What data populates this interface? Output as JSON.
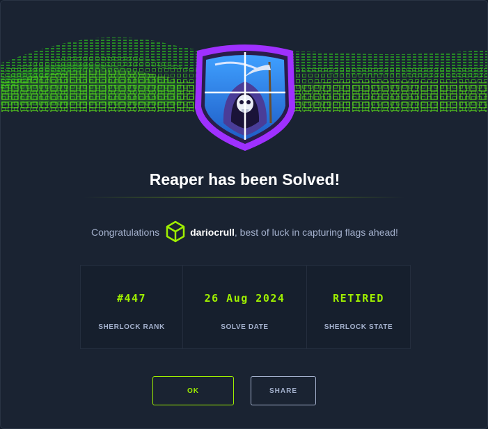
{
  "colors": {
    "accent": "#9fef00",
    "background": "#1a2332",
    "text_muted": "#a4b1cd",
    "badge_border": "#9f30ff"
  },
  "header": {
    "hero_graphic": "green-cube-wave",
    "badge_icon": "reaper-shield-badge"
  },
  "title": "Reaper has been Solved!",
  "congrats": {
    "prefix": "Congratulations",
    "avatar_icon": "green-cube-icon",
    "username": "dariocrull",
    "suffix": ", best of luck in capturing flags ahead!"
  },
  "stats": [
    {
      "value": "#447",
      "label": "SHERLOCK RANK"
    },
    {
      "value": "26 Aug 2024",
      "label": "SOLVE DATE"
    },
    {
      "value": "RETIRED",
      "label": "SHERLOCK STATE"
    }
  ],
  "buttons": {
    "ok_label": "OK",
    "share_label": "SHARE"
  }
}
